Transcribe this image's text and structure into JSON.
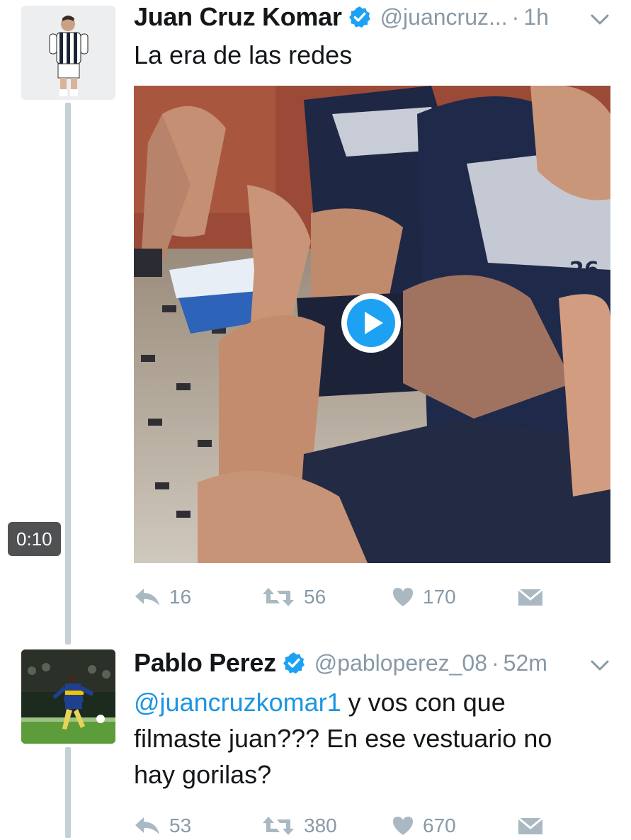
{
  "tweet1": {
    "author_name": "Juan Cruz Komar",
    "handle": "@juancruz...",
    "separator": "·",
    "time": "1h",
    "text": "La era de las redes",
    "video_duration": "0:10",
    "actions": {
      "reply_count": "16",
      "retweet_count": "56",
      "like_count": "170"
    }
  },
  "tweet2": {
    "author_name": "Pablo Perez",
    "handle": "@pabloperez_08",
    "separator": "·",
    "time": "52m",
    "mention": "@juancruzkomar1",
    "text_line1_rest": " y vos con que",
    "text_line2": "filmaste juan??? En ese vestuario no",
    "text_line3": "hay gorilas?",
    "actions": {
      "reply_count": "53",
      "retweet_count": "380",
      "like_count": "670"
    }
  },
  "colors": {
    "verified": "#1da1f2",
    "mention": "#1b95e0",
    "muted": "#8899a6",
    "thread_line": "#c4cfd6"
  },
  "icons": {
    "reply": "reply-icon",
    "retweet": "retweet-icon",
    "like": "heart-icon",
    "dm": "envelope-icon",
    "verified": "verified-badge-icon",
    "caret": "chevron-down-icon",
    "play": "play-icon"
  }
}
